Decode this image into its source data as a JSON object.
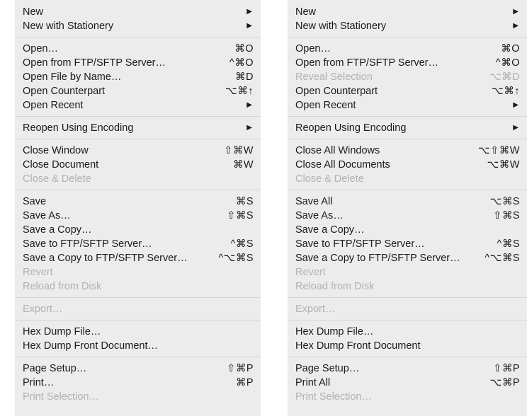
{
  "left_menu": {
    "groups": [
      [
        {
          "label": "New",
          "submenu": true,
          "arrow": "▶"
        },
        {
          "label": "New with Stationery",
          "submenu": true,
          "arrow": "▶"
        }
      ],
      [
        {
          "label": "Open…",
          "shortcut": "⌘O"
        },
        {
          "label": "Open from FTP/SFTP Server…",
          "shortcut": "^⌘O"
        },
        {
          "label": "Open File by Name…",
          "shortcut": "⌘D"
        },
        {
          "label": "Open Counterpart",
          "shortcut": "⌥⌘↑"
        },
        {
          "label": "Open Recent",
          "submenu": true,
          "arrow": "▶"
        }
      ],
      [
        {
          "label": "Reopen Using Encoding",
          "submenu": true,
          "arrow": "▶"
        }
      ],
      [
        {
          "label": "Close Window",
          "shortcut": "⇧⌘W"
        },
        {
          "label": "Close Document",
          "shortcut": "⌘W"
        },
        {
          "label": "Close & Delete",
          "disabled": true
        }
      ],
      [
        {
          "label": "Save",
          "shortcut": "⌘S"
        },
        {
          "label": "Save As…",
          "shortcut": "⇧⌘S"
        },
        {
          "label": "Save a Copy…"
        },
        {
          "label": "Save to FTP/SFTP Server…",
          "shortcut": "^⌘S"
        },
        {
          "label": "Save a Copy to FTP/SFTP Server…",
          "shortcut": "^⌥⌘S"
        },
        {
          "label": "Revert",
          "disabled": true
        },
        {
          "label": "Reload from Disk",
          "disabled": true
        }
      ],
      [
        {
          "label": "Export…",
          "disabled": true
        }
      ],
      [
        {
          "label": "Hex Dump File…"
        },
        {
          "label": "Hex Dump Front Document…"
        }
      ],
      [
        {
          "label": "Page Setup…",
          "shortcut": "⇧⌘P"
        },
        {
          "label": "Print…",
          "shortcut": "⌘P"
        },
        {
          "label": "Print Selection…",
          "disabled": true
        }
      ]
    ]
  },
  "right_menu": {
    "groups": [
      [
        {
          "label": "New",
          "submenu": true,
          "arrow": "▶"
        },
        {
          "label": "New with Stationery",
          "submenu": true,
          "arrow": "▶"
        }
      ],
      [
        {
          "label": "Open…",
          "shortcut": "⌘O"
        },
        {
          "label": "Open from FTP/SFTP Server…",
          "shortcut": "^⌘O"
        },
        {
          "label": "Reveal Selection",
          "shortcut": "⌥⌘D",
          "disabled": true
        },
        {
          "label": "Open Counterpart",
          "shortcut": "⌥⌘↑"
        },
        {
          "label": "Open Recent",
          "submenu": true,
          "arrow": "▶"
        }
      ],
      [
        {
          "label": "Reopen Using Encoding",
          "submenu": true,
          "arrow": "▶"
        }
      ],
      [
        {
          "label": "Close All Windows",
          "shortcut": "⌥⇧⌘W"
        },
        {
          "label": "Close All Documents",
          "shortcut": "⌥⌘W"
        },
        {
          "label": "Close & Delete",
          "disabled": true
        }
      ],
      [
        {
          "label": "Save All",
          "shortcut": "⌥⌘S"
        },
        {
          "label": "Save As…",
          "shortcut": "⇧⌘S"
        },
        {
          "label": "Save a Copy…"
        },
        {
          "label": "Save to FTP/SFTP Server…",
          "shortcut": "^⌘S"
        },
        {
          "label": "Save a Copy to FTP/SFTP Server…",
          "shortcut": "^⌥⌘S"
        },
        {
          "label": "Revert",
          "disabled": true
        },
        {
          "label": "Reload from Disk",
          "disabled": true
        }
      ],
      [
        {
          "label": "Export…",
          "disabled": true
        }
      ],
      [
        {
          "label": "Hex Dump File…"
        },
        {
          "label": "Hex Dump Front Document"
        }
      ],
      [
        {
          "label": "Page Setup…",
          "shortcut": "⇧⌘P"
        },
        {
          "label": "Print All",
          "shortcut": "⌥⌘P"
        },
        {
          "label": "Print Selection…",
          "disabled": true
        }
      ]
    ]
  },
  "colors": {
    "menu_background": "#ececec",
    "text": "#1a1a1a",
    "disabled_text": "#b2b2b2",
    "separator": "#d4d4d4"
  }
}
